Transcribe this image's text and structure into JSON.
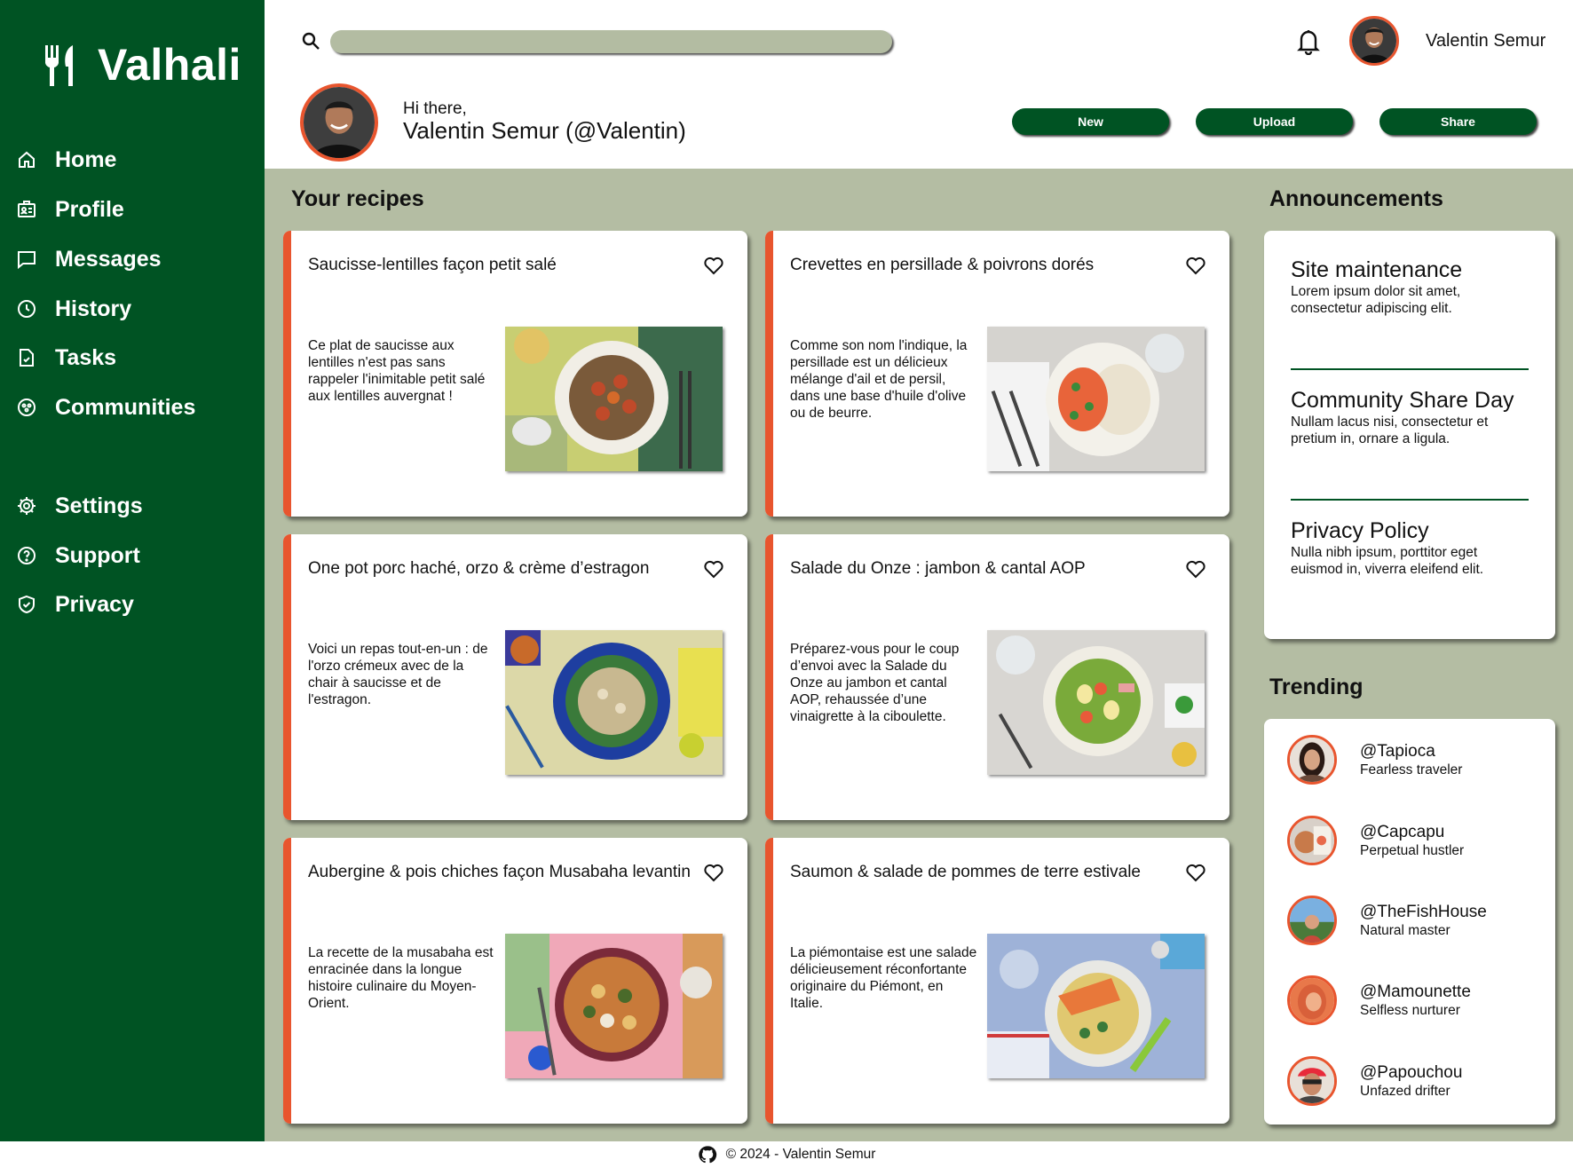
{
  "app": {
    "name": "Valhali"
  },
  "sidebar": {
    "items": [
      {
        "label": "Home",
        "icon": "home-icon"
      },
      {
        "label": "Profile",
        "icon": "id-card-icon"
      },
      {
        "label": "Messages",
        "icon": "message-icon"
      },
      {
        "label": "History",
        "icon": "clock-icon"
      },
      {
        "label": "Tasks",
        "icon": "task-icon"
      },
      {
        "label": "Communities",
        "icon": "community-icon"
      }
    ],
    "bottom_items": [
      {
        "label": "Settings",
        "icon": "gear-icon"
      },
      {
        "label": "Support",
        "icon": "help-icon"
      },
      {
        "label": "Privacy",
        "icon": "shield-icon"
      }
    ]
  },
  "header": {
    "search_placeholder": "",
    "username": "Valentin Semur",
    "greeting_small": "Hi there,",
    "greeting_name": "Valentin Semur (@Valentin)",
    "buttons": {
      "new": "New",
      "upload": "Upload",
      "share": "Share"
    }
  },
  "recipes": {
    "title": "Your recipes",
    "items": [
      {
        "title": "Saucisse-lentilles façon petit salé",
        "description": "Ce plat de saucisse aux lentilles n'est pas sans rappeler l'inimitable petit salé aux lentilles auvergnat !"
      },
      {
        "title": "Crevettes en persillade & poivrons dorés",
        "description": "Comme son nom l'indique, la persillade est un délicieux mélange d'ail et de persil, dans une base d'huile d'olive ou de beurre."
      },
      {
        "title": "One pot porc haché, orzo & crème d’estragon",
        "description": "Voici un repas tout-en-un : de l'orzo crémeux avec de la chair à saucisse et de l'estragon."
      },
      {
        "title": "Salade du Onze : jambon & cantal AOP",
        "description": "Préparez-vous pour le coup d’envoi avec la Salade du Onze au jambon et cantal AOP, rehaussée d’une vinaigrette à la ciboulette."
      },
      {
        "title": "Aubergine & pois chiches façon Musabaha levantin",
        "description": "La recette de la musabaha est enracinée dans la longue histoire culinaire du Moyen-Orient."
      },
      {
        "title": "Saumon & salade de pommes de terre estivale",
        "description": "La piémontaise est une salade délicieusement réconfortante originaire du Piémont, en Italie."
      }
    ]
  },
  "announcements": {
    "title": "Announcements",
    "items": [
      {
        "title": "Site maintenance",
        "text": "Lorem ipsum dolor sit amet, consectetur adipiscing elit."
      },
      {
        "title": "Community Share Day",
        "text": "Nullam lacus nisi, consectetur et pretium in, ornare a ligula."
      },
      {
        "title": "Privacy Policy",
        "text": "Nulla nibh ipsum, porttitor eget euismod in, viverra eleifend elit."
      }
    ]
  },
  "trending": {
    "title": "Trending",
    "items": [
      {
        "handle": "@Tapioca",
        "tagline": "Fearless traveler"
      },
      {
        "handle": "@Capcapu",
        "tagline": "Perpetual hustler"
      },
      {
        "handle": "@TheFishHouse",
        "tagline": "Natural master"
      },
      {
        "handle": "@Mamounette",
        "tagline": "Selfless nurturer"
      },
      {
        "handle": "@Papouchou",
        "tagline": "Unfazed drifter"
      }
    ]
  },
  "footer": {
    "text": "© 2024 - Valentin Semur",
    "icon": "github-icon"
  },
  "colors": {
    "sidebar": "#005323",
    "accent": "#e8552e",
    "main_bg": "#b4bda3",
    "search": "#b3bca2"
  }
}
